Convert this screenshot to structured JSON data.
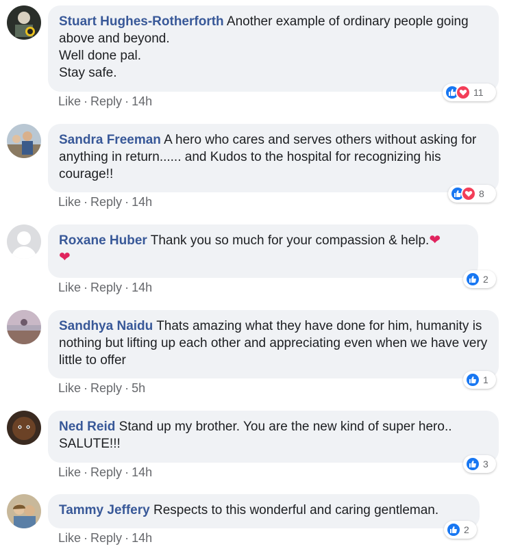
{
  "comments": [
    {
      "author": "Stuart Hughes-Rotherforth",
      "text": "Another example of ordinary people going above and beyond.",
      "lines_extra": [
        "Well done pal.",
        "Stay safe."
      ],
      "reaction_count": "11",
      "reactions": [
        "like",
        "love"
      ],
      "time": "14h"
    },
    {
      "author": "Sandra Freeman",
      "text": "A hero who cares and serves others without asking for anything in return...... and Kudos to the hospital for recognizing his courage!!",
      "reaction_count": "8",
      "reactions": [
        "like",
        "love"
      ],
      "time": "14h"
    },
    {
      "author": "Roxane Huber",
      "text": "Thank you so much for your compassion & help.",
      "emoji": "❤",
      "emoji2": "❤",
      "reaction_count": "2",
      "reactions": [
        "like"
      ],
      "time": "14h"
    },
    {
      "author": "Sandhya Naidu",
      "text": "Thats amazing what they have done for him, humanity is nothing but lifting up each other and appreciating even when we have very little to offer",
      "reaction_count": "1",
      "reactions": [
        "like"
      ],
      "time": "5h"
    },
    {
      "author": "Ned Reid",
      "text": "Stand up my brother. You are the new kind of super hero.. SALUTE!!!",
      "reaction_count": "3",
      "reactions": [
        "like"
      ],
      "time": "14h"
    },
    {
      "author": "Tammy Jeffery",
      "text": "Respects to this wonderful and caring gentleman.",
      "reaction_count": "2",
      "reactions": [
        "like"
      ],
      "time": "14h"
    }
  ],
  "labels": {
    "like": "Like",
    "reply": "Reply",
    "sep": "·"
  },
  "colors": {
    "author": "#385898",
    "bubble": "#f0f2f5",
    "meta": "#65676b",
    "like_blue": "#1877f2",
    "love_red": "#f33e58"
  }
}
